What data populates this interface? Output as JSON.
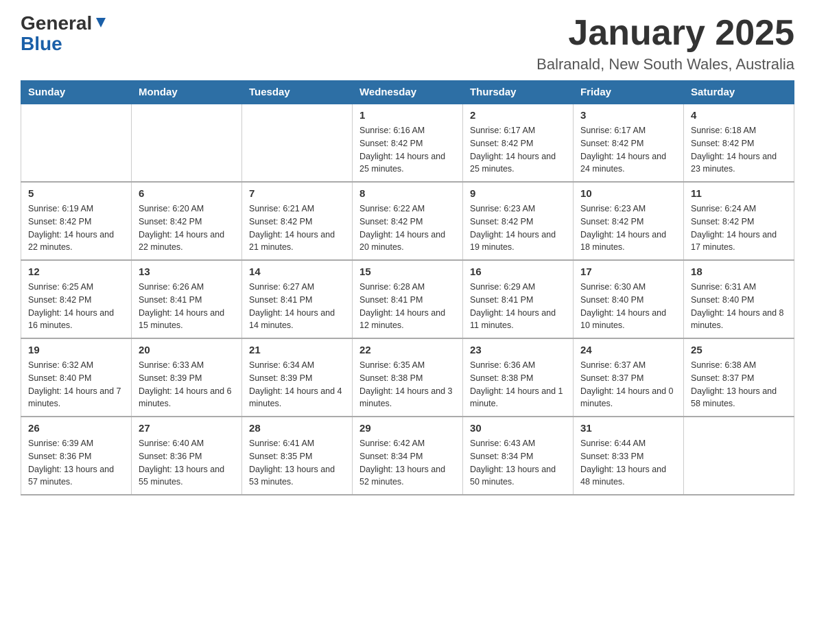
{
  "logo": {
    "part1": "General",
    "part2": "Blue"
  },
  "title": "January 2025",
  "subtitle": "Balranald, New South Wales, Australia",
  "weekdays": [
    "Sunday",
    "Monday",
    "Tuesday",
    "Wednesday",
    "Thursday",
    "Friday",
    "Saturday"
  ],
  "weeks": [
    [
      {
        "day": "",
        "info": ""
      },
      {
        "day": "",
        "info": ""
      },
      {
        "day": "",
        "info": ""
      },
      {
        "day": "1",
        "info": "Sunrise: 6:16 AM\nSunset: 8:42 PM\nDaylight: 14 hours and 25 minutes."
      },
      {
        "day": "2",
        "info": "Sunrise: 6:17 AM\nSunset: 8:42 PM\nDaylight: 14 hours and 25 minutes."
      },
      {
        "day": "3",
        "info": "Sunrise: 6:17 AM\nSunset: 8:42 PM\nDaylight: 14 hours and 24 minutes."
      },
      {
        "day": "4",
        "info": "Sunrise: 6:18 AM\nSunset: 8:42 PM\nDaylight: 14 hours and 23 minutes."
      }
    ],
    [
      {
        "day": "5",
        "info": "Sunrise: 6:19 AM\nSunset: 8:42 PM\nDaylight: 14 hours and 22 minutes."
      },
      {
        "day": "6",
        "info": "Sunrise: 6:20 AM\nSunset: 8:42 PM\nDaylight: 14 hours and 22 minutes."
      },
      {
        "day": "7",
        "info": "Sunrise: 6:21 AM\nSunset: 8:42 PM\nDaylight: 14 hours and 21 minutes."
      },
      {
        "day": "8",
        "info": "Sunrise: 6:22 AM\nSunset: 8:42 PM\nDaylight: 14 hours and 20 minutes."
      },
      {
        "day": "9",
        "info": "Sunrise: 6:23 AM\nSunset: 8:42 PM\nDaylight: 14 hours and 19 minutes."
      },
      {
        "day": "10",
        "info": "Sunrise: 6:23 AM\nSunset: 8:42 PM\nDaylight: 14 hours and 18 minutes."
      },
      {
        "day": "11",
        "info": "Sunrise: 6:24 AM\nSunset: 8:42 PM\nDaylight: 14 hours and 17 minutes."
      }
    ],
    [
      {
        "day": "12",
        "info": "Sunrise: 6:25 AM\nSunset: 8:42 PM\nDaylight: 14 hours and 16 minutes."
      },
      {
        "day": "13",
        "info": "Sunrise: 6:26 AM\nSunset: 8:41 PM\nDaylight: 14 hours and 15 minutes."
      },
      {
        "day": "14",
        "info": "Sunrise: 6:27 AM\nSunset: 8:41 PM\nDaylight: 14 hours and 14 minutes."
      },
      {
        "day": "15",
        "info": "Sunrise: 6:28 AM\nSunset: 8:41 PM\nDaylight: 14 hours and 12 minutes."
      },
      {
        "day": "16",
        "info": "Sunrise: 6:29 AM\nSunset: 8:41 PM\nDaylight: 14 hours and 11 minutes."
      },
      {
        "day": "17",
        "info": "Sunrise: 6:30 AM\nSunset: 8:40 PM\nDaylight: 14 hours and 10 minutes."
      },
      {
        "day": "18",
        "info": "Sunrise: 6:31 AM\nSunset: 8:40 PM\nDaylight: 14 hours and 8 minutes."
      }
    ],
    [
      {
        "day": "19",
        "info": "Sunrise: 6:32 AM\nSunset: 8:40 PM\nDaylight: 14 hours and 7 minutes."
      },
      {
        "day": "20",
        "info": "Sunrise: 6:33 AM\nSunset: 8:39 PM\nDaylight: 14 hours and 6 minutes."
      },
      {
        "day": "21",
        "info": "Sunrise: 6:34 AM\nSunset: 8:39 PM\nDaylight: 14 hours and 4 minutes."
      },
      {
        "day": "22",
        "info": "Sunrise: 6:35 AM\nSunset: 8:38 PM\nDaylight: 14 hours and 3 minutes."
      },
      {
        "day": "23",
        "info": "Sunrise: 6:36 AM\nSunset: 8:38 PM\nDaylight: 14 hours and 1 minute."
      },
      {
        "day": "24",
        "info": "Sunrise: 6:37 AM\nSunset: 8:37 PM\nDaylight: 14 hours and 0 minutes."
      },
      {
        "day": "25",
        "info": "Sunrise: 6:38 AM\nSunset: 8:37 PM\nDaylight: 13 hours and 58 minutes."
      }
    ],
    [
      {
        "day": "26",
        "info": "Sunrise: 6:39 AM\nSunset: 8:36 PM\nDaylight: 13 hours and 57 minutes."
      },
      {
        "day": "27",
        "info": "Sunrise: 6:40 AM\nSunset: 8:36 PM\nDaylight: 13 hours and 55 minutes."
      },
      {
        "day": "28",
        "info": "Sunrise: 6:41 AM\nSunset: 8:35 PM\nDaylight: 13 hours and 53 minutes."
      },
      {
        "day": "29",
        "info": "Sunrise: 6:42 AM\nSunset: 8:34 PM\nDaylight: 13 hours and 52 minutes."
      },
      {
        "day": "30",
        "info": "Sunrise: 6:43 AM\nSunset: 8:34 PM\nDaylight: 13 hours and 50 minutes."
      },
      {
        "day": "31",
        "info": "Sunrise: 6:44 AM\nSunset: 8:33 PM\nDaylight: 13 hours and 48 minutes."
      },
      {
        "day": "",
        "info": ""
      }
    ]
  ]
}
